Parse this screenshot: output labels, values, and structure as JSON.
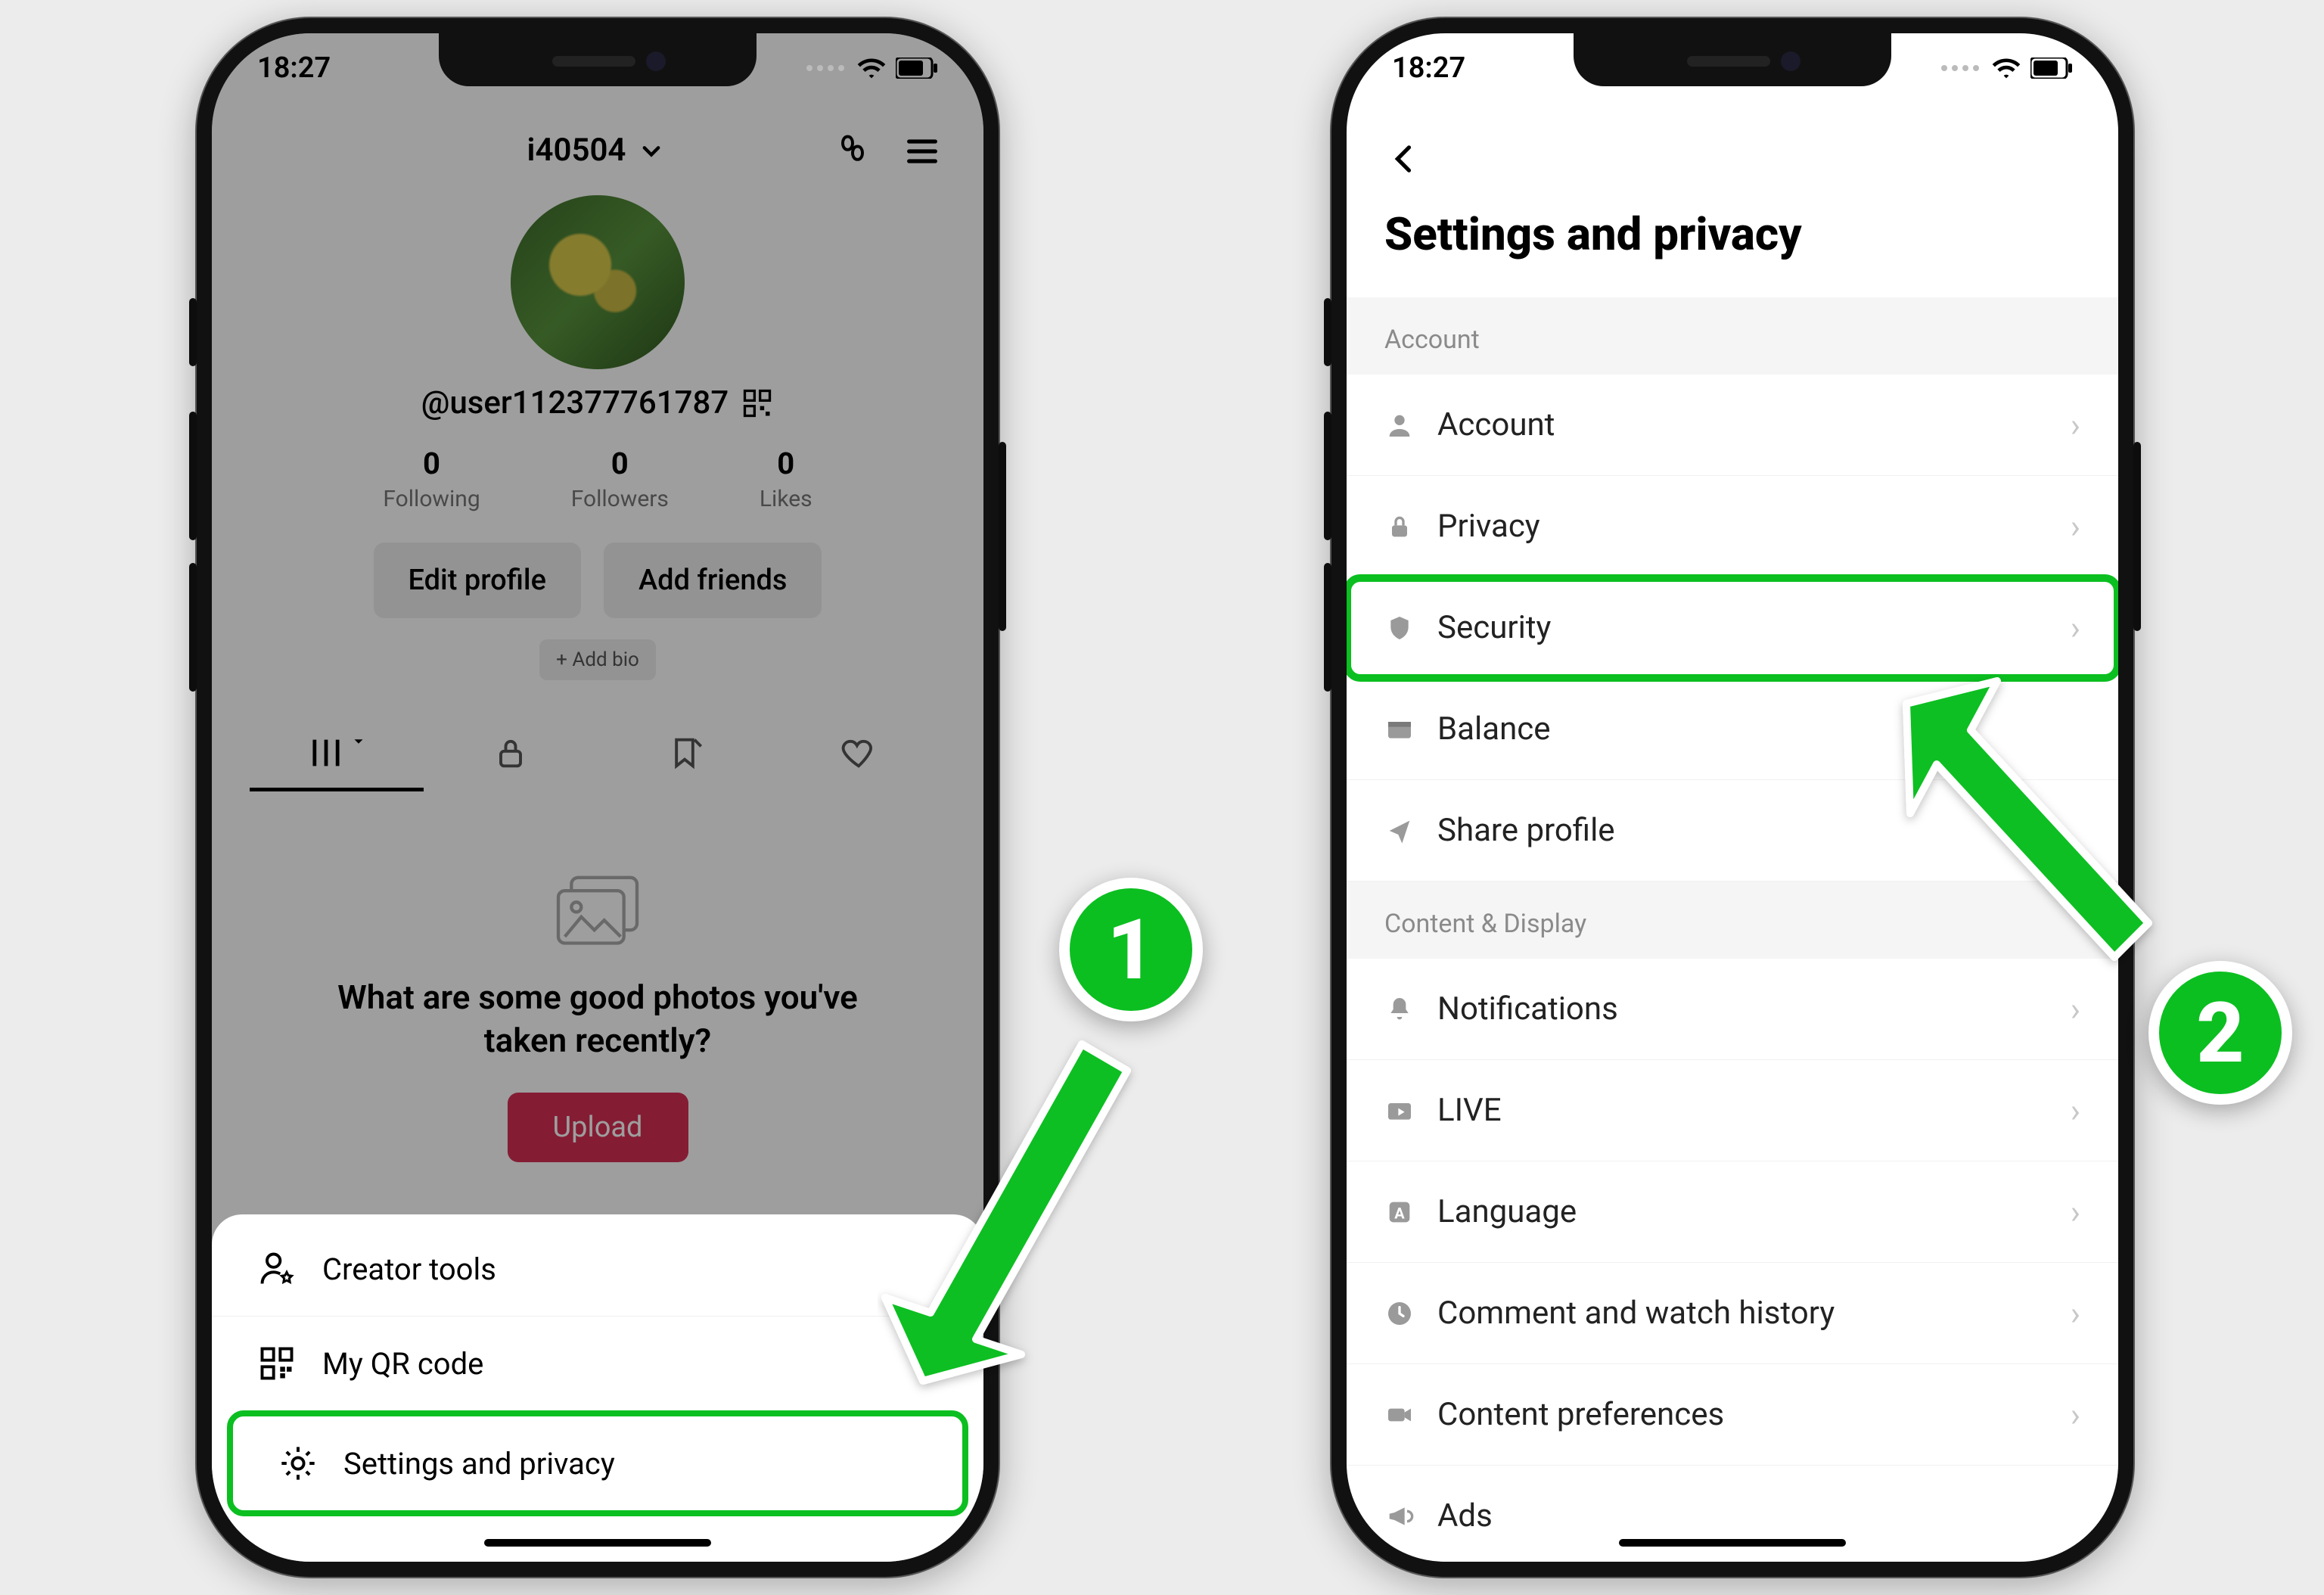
{
  "colors": {
    "accent": "#0bbf20",
    "upload": "#d52f55"
  },
  "phone1": {
    "status_time": "18:27",
    "top_username": "i40504",
    "handle": "@user112377761787",
    "stats": {
      "following": {
        "value": "0",
        "label": "Following"
      },
      "followers": {
        "value": "0",
        "label": "Followers"
      },
      "likes": {
        "value": "0",
        "label": "Likes"
      }
    },
    "buttons": {
      "edit_profile": "Edit profile",
      "add_friends": "Add friends",
      "add_bio": "+ Add bio",
      "upload": "Upload"
    },
    "empty_state_text": "What are some good photos you've taken recently?",
    "sheet": {
      "creator_tools": "Creator tools",
      "qr_code": "My QR code",
      "settings": "Settings and privacy"
    }
  },
  "phone2": {
    "status_time": "18:27",
    "page_title": "Settings and privacy",
    "sections": {
      "account_header": "Account",
      "content_header": "Content & Display"
    },
    "items": {
      "account": "Account",
      "privacy": "Privacy",
      "security": "Security",
      "balance": "Balance",
      "share_profile": "Share profile",
      "notifications": "Notifications",
      "live": "LIVE",
      "language": "Language",
      "history": "Comment and watch history",
      "content_prefs": "Content preferences",
      "ads": "Ads"
    }
  },
  "annotations": {
    "step1": "1",
    "step2": "2"
  }
}
